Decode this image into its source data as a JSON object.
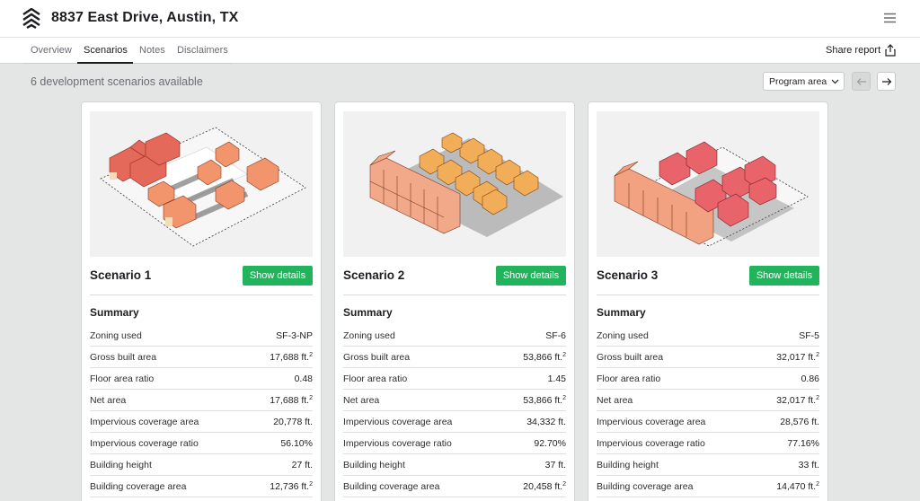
{
  "header": {
    "title": "8837 East Drive, Austin, TX"
  },
  "tabs": [
    "Overview",
    "Scenarios",
    "Notes",
    "Disclaimers"
  ],
  "active_tab": "Scenarios",
  "share_label": "Share report",
  "available_text": "6 development scenarios available",
  "sort_select": {
    "value": "Program area"
  },
  "colors": {
    "accent": "#22b35d",
    "bldg_red": "#e06a5c",
    "bldg_orange": "#f0a453",
    "bldg_salmon": "#f3a07f"
  },
  "summary_label": "Summary",
  "show_details_label": "Show details",
  "scenarios": [
    {
      "title": "Scenario 1",
      "rows": [
        {
          "label": "Zoning used",
          "value": "SF-3-NP"
        },
        {
          "label": "Gross built area",
          "value": "17,688 ft.",
          "sup": "2"
        },
        {
          "label": "Floor area ratio",
          "value": "0.48"
        },
        {
          "label": "Net area",
          "value": "17,688 ft.",
          "sup": "2"
        },
        {
          "label": "Impervious coverage area",
          "value": "20,778 ft."
        },
        {
          "label": "Impervious coverage ratio",
          "value": "56.10%"
        },
        {
          "label": "Building height",
          "value": "27 ft."
        },
        {
          "label": "Building coverage area",
          "value": "12,736 ft.",
          "sup": "2"
        }
      ]
    },
    {
      "title": "Scenario 2",
      "rows": [
        {
          "label": "Zoning used",
          "value": "SF-6"
        },
        {
          "label": "Gross built area",
          "value": "53,866 ft.",
          "sup": "2"
        },
        {
          "label": "Floor area ratio",
          "value": "1.45"
        },
        {
          "label": "Net area",
          "value": "53,866 ft.",
          "sup": "2"
        },
        {
          "label": "Impervious coverage area",
          "value": "34,332 ft."
        },
        {
          "label": "Impervious coverage ratio",
          "value": "92.70%"
        },
        {
          "label": "Building height",
          "value": "37 ft."
        },
        {
          "label": "Building coverage area",
          "value": "20,458 ft.",
          "sup": "2"
        }
      ]
    },
    {
      "title": "Scenario 3",
      "rows": [
        {
          "label": "Zoning used",
          "value": "SF-5"
        },
        {
          "label": "Gross built area",
          "value": "32,017 ft.",
          "sup": "2"
        },
        {
          "label": "Floor area ratio",
          "value": "0.86"
        },
        {
          "label": "Net area",
          "value": "32,017 ft.",
          "sup": "2"
        },
        {
          "label": "Impervious coverage area",
          "value": "28,576 ft."
        },
        {
          "label": "Impervious coverage ratio",
          "value": "77.16%"
        },
        {
          "label": "Building height",
          "value": "33 ft."
        },
        {
          "label": "Building coverage area",
          "value": "14,470 ft.",
          "sup": "2"
        }
      ]
    }
  ]
}
